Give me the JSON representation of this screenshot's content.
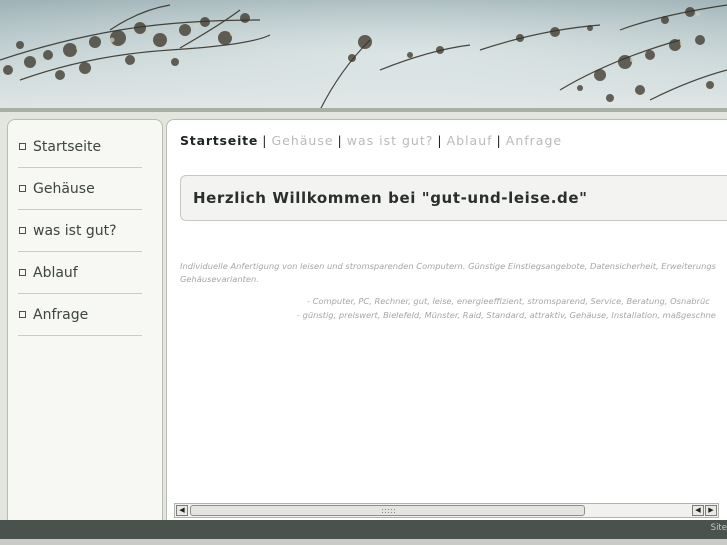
{
  "sidebar": {
    "items": [
      {
        "label": "Startseite"
      },
      {
        "label": "Gehäuse"
      },
      {
        "label": "was ist gut?"
      },
      {
        "label": "Ablauf"
      },
      {
        "label": "Anfrage"
      }
    ]
  },
  "topnav": {
    "items": [
      {
        "label": "Startseite",
        "active": true
      },
      {
        "label": "Gehäuse",
        "active": false
      },
      {
        "label": "was ist gut?",
        "active": false
      },
      {
        "label": "Ablauf",
        "active": false
      },
      {
        "label": "Anfrage",
        "active": false
      }
    ],
    "separator": "|"
  },
  "main": {
    "heading": "Herzlich Willkommen bei \"gut-und-leise.de\"",
    "description": "Individuelle Anfertigung von leisen und stromsparenden Computern. Günstige Einstiegsangebote, Datensicherheit, Erweiterungs Gehäusevarianten.",
    "keywords_line1": "- Computer, PC, Rechner, gut, leise, energieeffizient, stromsparend, Service, Beratung, Osnabrüc",
    "keywords_line2": "- günstig, preiswert, Bielefeld, Münster, Raid, Standard, attraktiv, Gehäuse, Installation, maßgeschne"
  },
  "footer": {
    "text": "Site"
  },
  "colors": {
    "footer_bg": "#4a524d",
    "nav_active": "#1e2420",
    "nav_inactive": "#b8bcb6"
  }
}
